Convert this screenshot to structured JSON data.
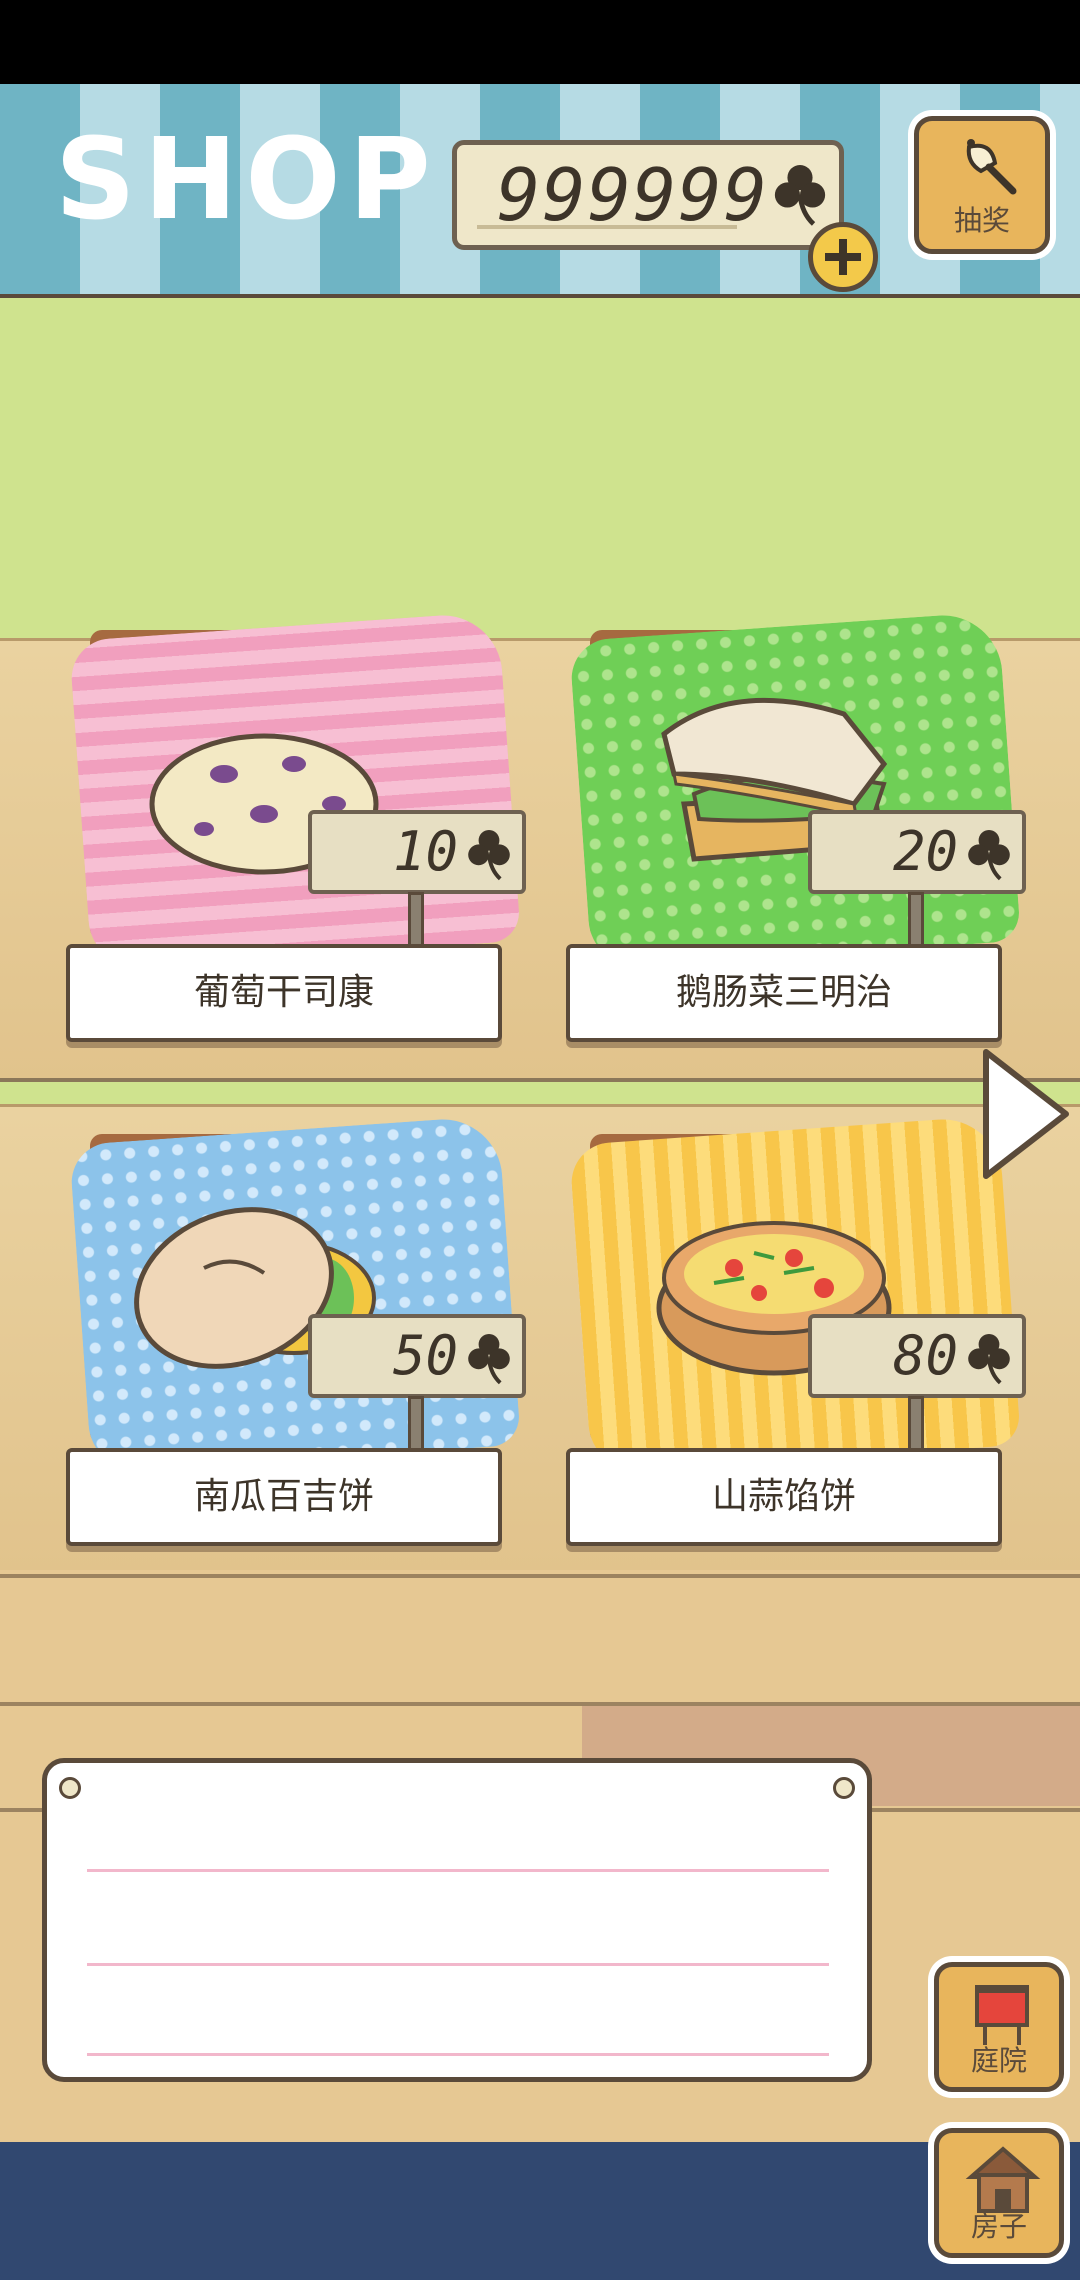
{
  "header": {
    "title": "SHOP",
    "coins": "999999",
    "lottery_label": "抽奖"
  },
  "items": [
    {
      "name": "葡萄干司康",
      "price": "10",
      "cloth": "pink"
    },
    {
      "name": "鹅肠菜三明治",
      "price": "20",
      "cloth": "green"
    },
    {
      "name": "南瓜百吉饼",
      "price": "50",
      "cloth": "blue"
    },
    {
      "name": "山蒜馅饼",
      "price": "80",
      "cloth": "yellow"
    }
  ],
  "nav": {
    "yard_label": "庭院",
    "house_label": "房子"
  },
  "icons": {
    "currency": "clover-icon",
    "add": "plus-icon",
    "lottery": "bell-icon",
    "next": "chevron-right-icon",
    "yard": "yard-icon",
    "house": "house-icon"
  },
  "colors": {
    "awning_dark": "#6fb4c4",
    "awning_light": "#b6dbe4",
    "wall": "#cfe38e",
    "wood": "#e6c893",
    "button": "#e8b55c",
    "bottom_band": "#314870"
  }
}
